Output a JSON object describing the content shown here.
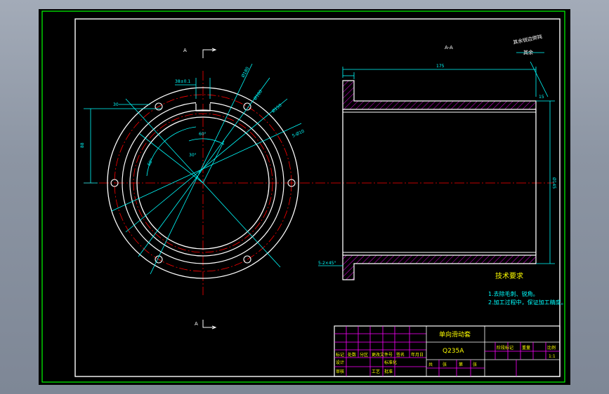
{
  "drawing": {
    "section_marker_top": "A",
    "section_marker_bottom": "A",
    "side_view_label": "A-A",
    "front_view": {
      "dim_width_left": "30",
      "dim_top_small": "38±0.1",
      "dim_side_height": "88",
      "dim_diameter_1": "Ø180",
      "dim_diameter_2": "Ø160",
      "dim_diameter_3": "Ø150",
      "dim_diameter_4": "Ø136",
      "dim_hole": "5-Ø10",
      "angle_1": "60°",
      "angle_2": "30°",
      "angle_3": "60°"
    },
    "side_view": {
      "dim_length": "175",
      "dim_flange_thickness": "15",
      "dim_diameter_right": "Ø145",
      "dim_chamfer": "5-2×45°",
      "roughness_note_line1": "其余锐边倒钝",
      "roughness_note_line2": "其余"
    },
    "tech_requirements": {
      "title": "技术要求",
      "line1": "1.去除毛刺、锐角。",
      "line2": "2.加工过程中，保证加工精度。"
    }
  },
  "title_block": {
    "part_name": "单向滑动套",
    "material": "Q235A",
    "header_cells": [
      "标记",
      "处数",
      "分区",
      "更改文件号",
      "签名",
      "年月日"
    ],
    "row_design": [
      "设计",
      "",
      "标准化"
    ],
    "row_review": [
      "审核",
      "",
      ""
    ],
    "row_process": [
      "工艺",
      "",
      "批准"
    ],
    "right_cells": [
      "阶段标记",
      "重量",
      "比例"
    ],
    "scale": "1:1",
    "sheet": [
      "共",
      "张",
      "第",
      "张"
    ]
  },
  "colors": {
    "background": "#000000",
    "border": "#ffffff",
    "frame_green": "#00ff00",
    "outline": "#ffffff",
    "center_line": "#ff0000",
    "dimension": "#00ffff",
    "hatch": "#ff00ff",
    "text_yellow": "#ffff00"
  }
}
